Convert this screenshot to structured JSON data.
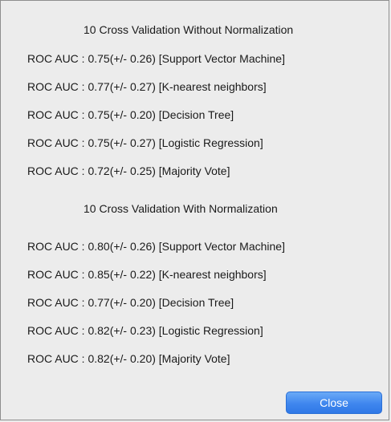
{
  "dialog": {
    "section1": {
      "title": "10 Cross Validation Without Normalization",
      "lines": [
        "ROC AUC : 0.75(+/- 0.26) [Support Vector Machine]",
        "ROC AUC : 0.77(+/- 0.27) [K-nearest neighbors]",
        "ROC AUC : 0.75(+/- 0.20) [Decision Tree]",
        "ROC AUC : 0.75(+/- 0.27) [Logistic Regression]",
        "ROC AUC : 0.72(+/- 0.25) [Majority Vote]"
      ]
    },
    "section2": {
      "title": "10 Cross Validation With Normalization",
      "lines": [
        "ROC AUC : 0.80(+/- 0.26) [Support Vector Machine]",
        "ROC AUC : 0.85(+/- 0.22) [K-nearest neighbors]",
        "ROC AUC : 0.77(+/- 0.20) [Decision Tree]",
        "ROC AUC : 0.82(+/- 0.23) [Logistic Regression]",
        "ROC AUC : 0.82(+/- 0.20) [Majority Vote]"
      ]
    },
    "close_label": "Close",
    "accent_color": "#3f86ee"
  }
}
